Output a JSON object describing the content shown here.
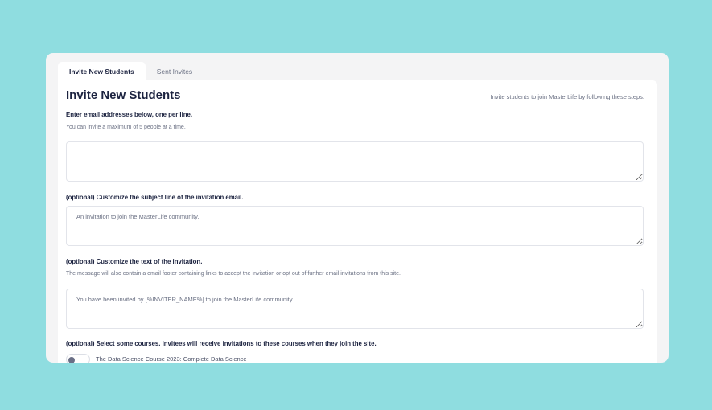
{
  "tabs": [
    {
      "label": "Invite New Students",
      "active": true
    },
    {
      "label": "Sent Invites",
      "active": false
    }
  ],
  "page": {
    "title": "Invite New Students",
    "hint": "Invite students to join MasterLife by following these steps:"
  },
  "emails": {
    "label": "Enter email addresses below, one per line.",
    "help": "You can invite a maximum of 5 people at a time.",
    "value": ""
  },
  "subject": {
    "label": "(optional) Customize the subject line of the invitation email.",
    "placeholder": "An invitation to join the MasterLife community."
  },
  "message": {
    "label": "(optional) Customize the text of the invitation.",
    "help": "The message will also contain a email footer containing links to accept the invitation or opt out of further email invitations from this site.",
    "placeholder": "You have been invited by [%INVITER_NAME%] to join the MasterLife community."
  },
  "courses": {
    "label": "(optional) Select some courses. Invitees will receive invitations to these courses when they join the site.",
    "items": [
      {
        "name": "The Data Science Course 2023: Complete Data Science",
        "selected": false
      }
    ]
  }
}
